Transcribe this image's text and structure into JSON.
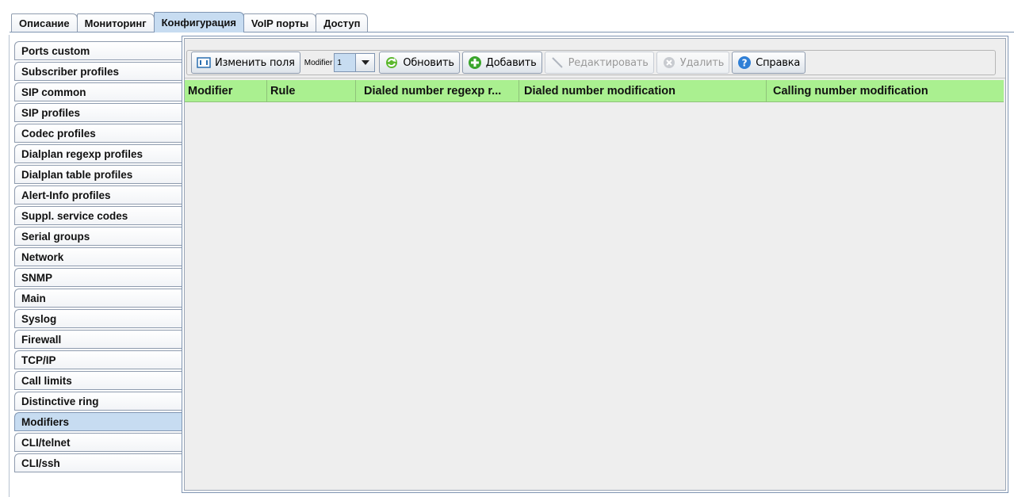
{
  "top_tabs": [
    {
      "label": "Описание",
      "active": false
    },
    {
      "label": "Мониторинг",
      "active": false
    },
    {
      "label": "Конфигурация",
      "active": true
    },
    {
      "label": "VoIP порты",
      "active": false
    },
    {
      "label": "Доступ",
      "active": false
    }
  ],
  "side_tabs": [
    {
      "label": "Ports custom"
    },
    {
      "label": "Subscriber profiles"
    },
    {
      "label": "SIP common"
    },
    {
      "label": "SIP profiles"
    },
    {
      "label": "Codec profiles"
    },
    {
      "label": "Dialplan regexp profiles"
    },
    {
      "label": "Dialplan table profiles"
    },
    {
      "label": "Alert-Info profiles"
    },
    {
      "label": "Suppl. service codes"
    },
    {
      "label": "Serial groups"
    },
    {
      "label": "Network"
    },
    {
      "label": "SNMP"
    },
    {
      "label": "Main"
    },
    {
      "label": "Syslog"
    },
    {
      "label": "Firewall"
    },
    {
      "label": "TCP/IP"
    },
    {
      "label": "Call limits"
    },
    {
      "label": "Distinctive ring"
    },
    {
      "label": "Modifiers",
      "active": true
    },
    {
      "label": "CLI/telnet"
    },
    {
      "label": "CLI/ssh"
    }
  ],
  "toolbar": {
    "edit_fields": "Изменить поля",
    "modifier_label": "Modifier",
    "modifier_value": "1",
    "refresh": "Обновить",
    "add": "Добавить",
    "edit": "Редактировать",
    "delete": "Удалить",
    "help": "Справка"
  },
  "table": {
    "columns": [
      "Modifier",
      "Rule",
      "Dialed number regexp r...",
      "Dialed number modification",
      "Calling number modification"
    ],
    "rows": []
  },
  "colors": {
    "header_green": "#aaf090",
    "active_tab": "#c7dcf1"
  }
}
